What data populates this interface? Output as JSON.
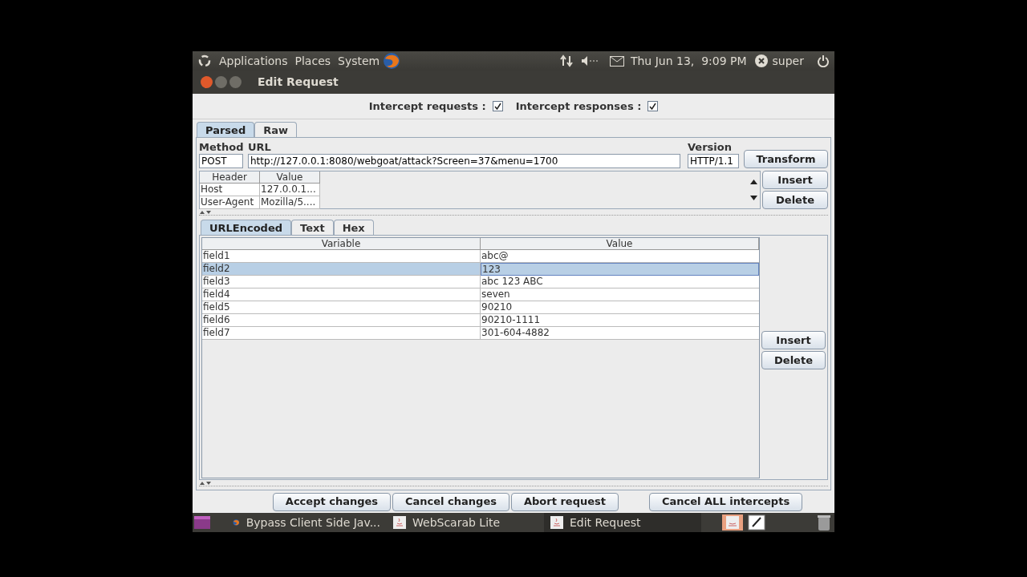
{
  "top_panel": {
    "menus": [
      "Applications",
      "Places",
      "System"
    ],
    "clock": "Thu Jun 13,  9:09 PM",
    "user": "super"
  },
  "window": {
    "title": "Edit Request"
  },
  "intercept": [
    {
      "label": "Intercept requests :",
      "checked": true
    },
    {
      "label": "Intercept responses :",
      "checked": true
    }
  ],
  "view_tabs": [
    {
      "label": "Parsed",
      "selected": true
    },
    {
      "label": "Raw",
      "selected": false
    }
  ],
  "request": {
    "method_label": "Method",
    "url_label": "URL",
    "version_label": "Version",
    "method": "POST",
    "url": "http://127.0.0.1:8080/webgoat/attack?Screen=37&menu=1700",
    "version": "HTTP/1.1",
    "transform": "Transform"
  },
  "headers": {
    "columns": [
      "Header",
      "Value"
    ],
    "rows": [
      [
        "Host",
        "127.0.0.1..."
      ],
      [
        "User-Agent",
        "Mozilla/5...."
      ]
    ],
    "buttons": [
      "Insert",
      "Delete"
    ]
  },
  "body_tabs": [
    {
      "label": "URLEncoded",
      "selected": true
    },
    {
      "label": "Text",
      "selected": false
    },
    {
      "label": "Hex",
      "selected": false
    }
  ],
  "params": {
    "columns": [
      "Variable",
      "Value"
    ],
    "rows": [
      {
        "variable": "field1",
        "value": "abc@",
        "selected": false
      },
      {
        "variable": "field2",
        "value": "123",
        "selected": true
      },
      {
        "variable": "field3",
        "value": "abc 123 ABC",
        "selected": false
      },
      {
        "variable": "field4",
        "value": "seven",
        "selected": false
      },
      {
        "variable": "field5",
        "value": "90210",
        "selected": false
      },
      {
        "variable": "field6",
        "value": "90210-1111",
        "selected": false
      },
      {
        "variable": "field7",
        "value": "301-604-4882",
        "selected": false
      }
    ],
    "buttons": [
      "Insert",
      "Delete"
    ]
  },
  "actions": [
    "Accept changes",
    "Cancel changes",
    "Abort request",
    "Cancel ALL intercepts"
  ],
  "taskbar": [
    {
      "label": "Bypass Client Side Jav...",
      "kind": "browser",
      "selected": false
    },
    {
      "label": "WebScarab Lite",
      "kind": "java",
      "selected": false
    },
    {
      "label": "Edit Request",
      "kind": "java",
      "selected": true
    }
  ]
}
